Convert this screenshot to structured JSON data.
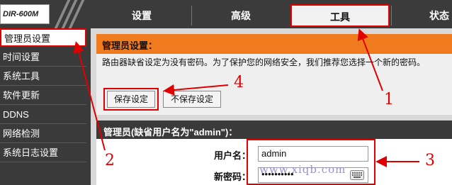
{
  "header": {
    "logo": "DIR-600M",
    "tabs": [
      {
        "label": "设置"
      },
      {
        "label": "高级"
      },
      {
        "label": "工具"
      },
      {
        "label": "状态"
      }
    ]
  },
  "sidebar": {
    "items": [
      {
        "label": "管理员设置"
      },
      {
        "label": "时间设置"
      },
      {
        "label": "系统工具"
      },
      {
        "label": "软件更新"
      },
      {
        "label": "DDNS"
      },
      {
        "label": "网络检测"
      },
      {
        "label": "系统日志设置"
      }
    ]
  },
  "admin_panel": {
    "title": "管理员设置：",
    "description": "路由器缺省设定为没有密码。为了保护您的网络安全，我们推荐您选择一个新的密码。",
    "save_label": "保存设定",
    "cancel_label": "不保存设定"
  },
  "account_panel": {
    "title": "管理员(缺省用户名为\"admin\")：",
    "username_label": "用户名：",
    "username_value": "admin",
    "password_label": "新密码：",
    "password_value": "••••••••••"
  },
  "annotations": {
    "n1": "1",
    "n2": "2",
    "n3": "3",
    "n4": "4",
    "watermark": "www.xiqb.com"
  },
  "colors": {
    "annotation": "#e00000",
    "panel_header": "#f07a1e",
    "bar": "#3b3b3b"
  },
  "icons": {
    "keyboard": "keyboard-icon"
  }
}
